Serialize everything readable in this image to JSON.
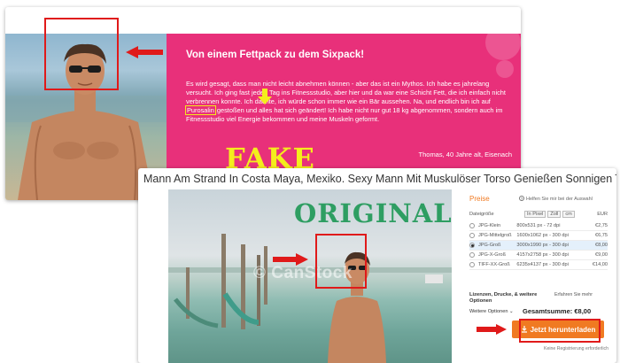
{
  "fake_card": {
    "title": "Von einem Fettpack zu dem Sixpack!",
    "body_before": "Es wird gesagt, dass man nicht leicht abnehmen können - aber das ist ein Mythos. Ich habe es jahrelang versucht. Ich ging fast jeden Tag ins Fitnessstudio, aber hier und da war eine Schicht Fett, die ich einfach nicht verbrennen konnte. Ich dachte, ich würde schon immer wie ein Bär aussehen. Na, und endlich bin ich auf",
    "highlight_word": "Purosalin",
    "body_after": "gestoßen und alles hat sich geändert! Ich habe nicht nur gut 18 kg abgenommen, sondern auch im Fitnessstudio viel Energie bekommen und meine Muskeln geformt.",
    "author": "Thomas, 40 Jahre alt, Eisenach",
    "stamp": "FAKE"
  },
  "original_card": {
    "header": "Mann Am Strand In Costa Maya, Mexiko. Sexy Mann Mit Muskulöser Torso Genießen Sonnigen Tag Am",
    "stamp": "ORIGINAL",
    "watermark": "© CanStock"
  },
  "panel": {
    "title": "Preise",
    "help": "Helfen Sie mir bei der Auswahl",
    "size_label": "Dateigröße",
    "units": [
      "In Pixel",
      "Zoll",
      "cm"
    ],
    "currency": "EUR",
    "rows": [
      {
        "name": "JPG-Klein",
        "dims": "800x531 px - 72 dpi",
        "price": "€2,75",
        "selected": false
      },
      {
        "name": "JPG-Mittelgroß",
        "dims": "1600x1062 px - 300 dpi",
        "price": "€6,75",
        "selected": false
      },
      {
        "name": "JPG-Groß",
        "dims": "3000x1990 px - 300 dpi",
        "price": "€8,00",
        "selected": true
      },
      {
        "name": "JPG-X-Groß",
        "dims": "4157x2758 px - 300 dpi",
        "price": "€9,00",
        "selected": false
      },
      {
        "name": "TIFF-XX-Groß",
        "dims": "6235x4137 px - 300 dpi",
        "price": "€14,00",
        "selected": false
      }
    ],
    "license_label": "Lizenzen, Drucke, & weitere Optionen",
    "more_info": "Erfahren Sie mehr",
    "options": "Weitere Optionen",
    "total": "Gesamtsumme: €8,00",
    "download": "Jetzt herunterladen",
    "footer": "Keine Registrierung erforderlich"
  },
  "colors": {
    "pink": "#e8307a",
    "accent": "#f07a22",
    "fake": "#f4ee1c",
    "original": "#2e9e62",
    "marker": "#e01a1a"
  }
}
